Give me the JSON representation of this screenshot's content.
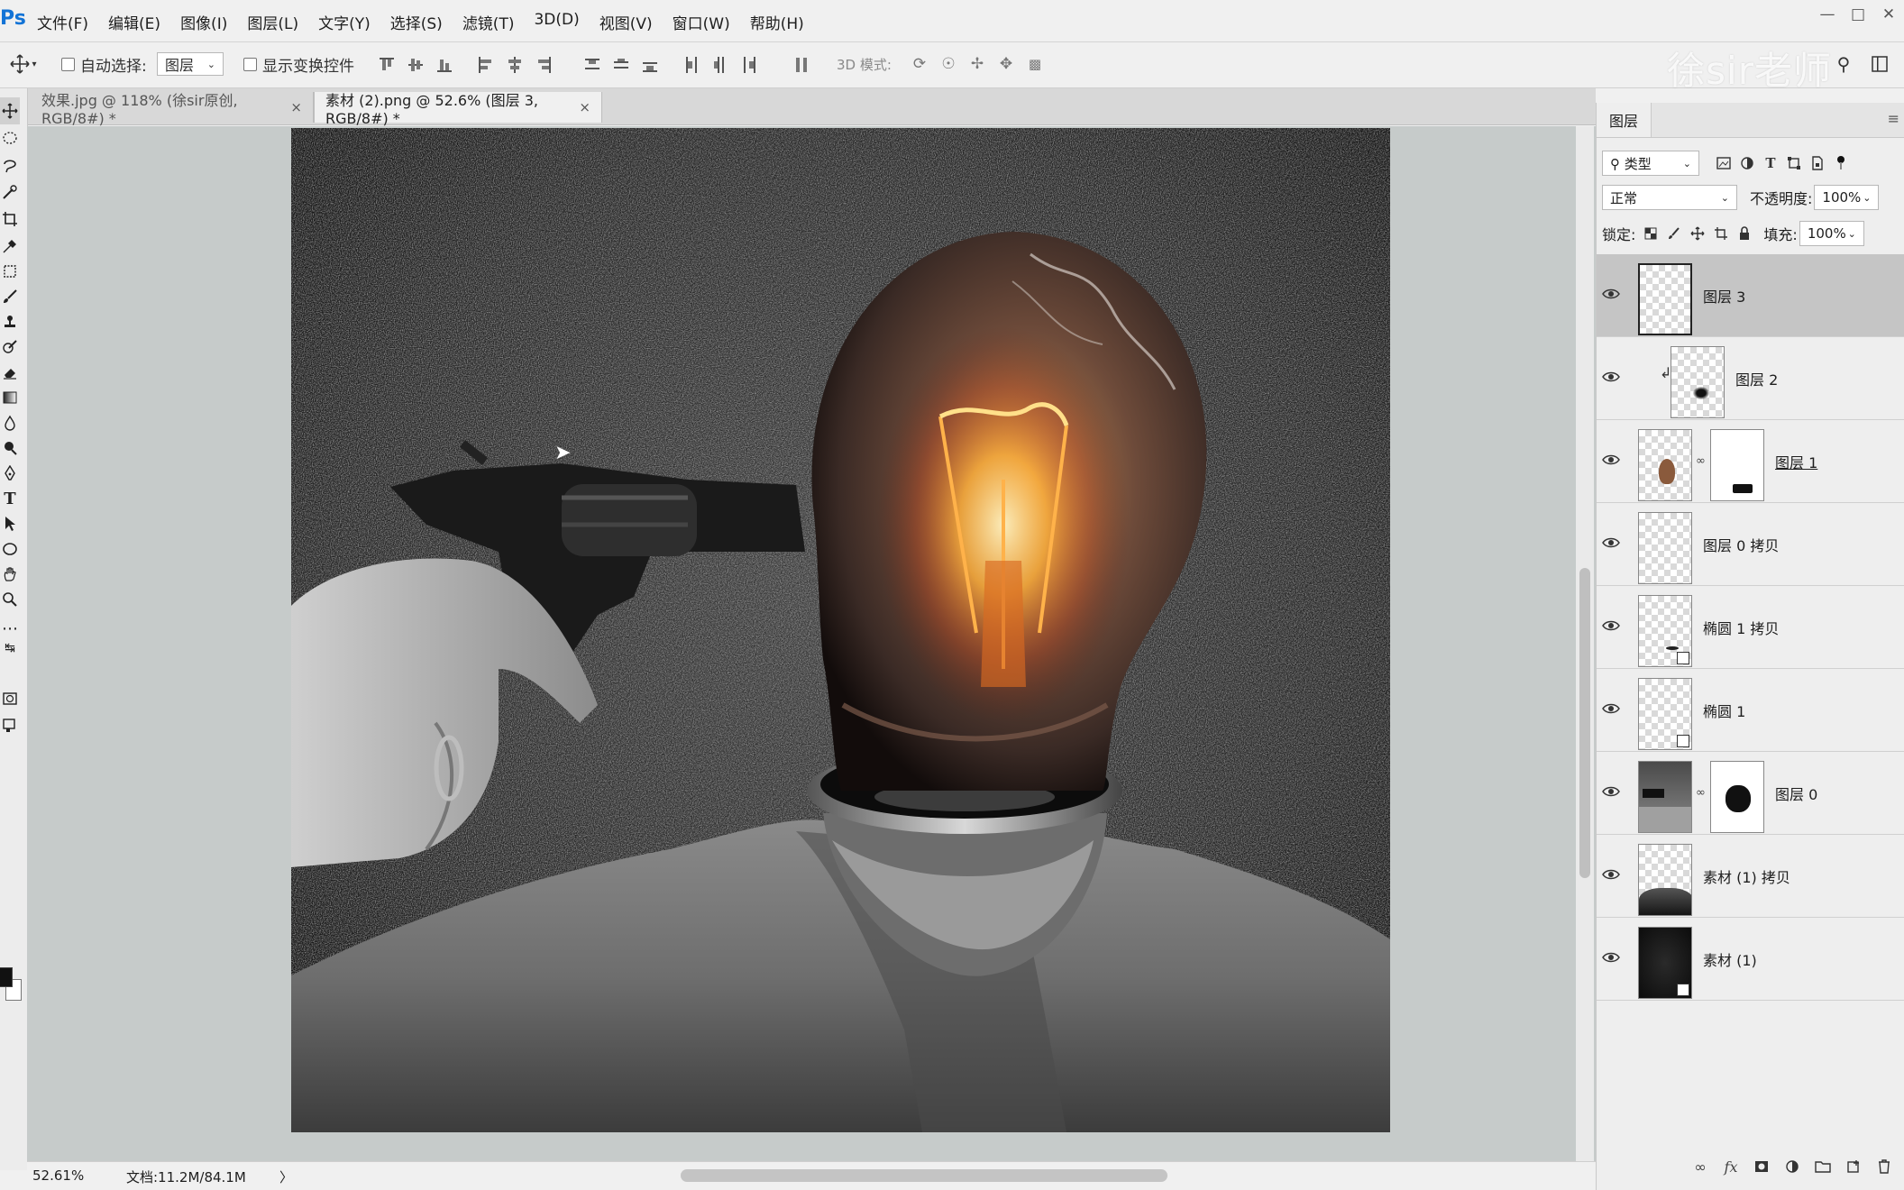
{
  "app": {
    "logo": "Ps",
    "menus": [
      "文件(F)",
      "编辑(E)",
      "图像(I)",
      "图层(L)",
      "文字(Y)",
      "选择(S)",
      "滤镜(T)",
      "3D(D)",
      "视图(V)",
      "窗口(W)",
      "帮助(H)"
    ],
    "window_controls": [
      "minimize-icon",
      "restore-icon",
      "close-icon"
    ]
  },
  "options": {
    "auto_select_label": "自动选择:",
    "auto_select_value": "图层",
    "show_transform_label": "显示变换控件",
    "mode_3d_label": "3D 模式:",
    "watermark": "徐sir老师"
  },
  "tabs": [
    {
      "label": "效果.jpg @ 118% (徐sir原创, RGB/8#) *",
      "close": "×",
      "active": false
    },
    {
      "label": "素材 (2).png @ 52.6% (图层 3, RGB/8#) *",
      "close": "×",
      "active": true
    }
  ],
  "status": {
    "zoom": "52.61%",
    "doc": "文档:11.2M/84.1M",
    "arrow": "〉"
  },
  "panel": {
    "tab_label": "图层",
    "filter_label": "类型",
    "blend_mode": "正常",
    "opacity_label": "不透明度:",
    "opacity_value": "100%",
    "lock_label": "锁定:",
    "fill_label": "填充:",
    "fill_value": "100%"
  },
  "layers": [
    {
      "name": "图层 3",
      "selected": true,
      "type": "empty"
    },
    {
      "name": "图层 2",
      "selected": false,
      "type": "clipped-blob"
    },
    {
      "name": "图层 1",
      "selected": false,
      "type": "bulb-mask"
    },
    {
      "name": "图层 0 拷贝",
      "selected": false,
      "type": "empty"
    },
    {
      "name": "椭圆 1 拷贝",
      "selected": false,
      "type": "shape"
    },
    {
      "name": "椭圆 1",
      "selected": false,
      "type": "shape"
    },
    {
      "name": "图层 0",
      "selected": false,
      "type": "photo-mask"
    },
    {
      "name": "素材 (1) 拷贝",
      "selected": false,
      "type": "dark-bottom"
    },
    {
      "name": "素材 (1)",
      "selected": false,
      "type": "smart-dark"
    }
  ],
  "colors": {
    "accent": "#1273d6",
    "canvas_bg": "#c6cbca",
    "selected_layer": "#c5c5c5"
  }
}
